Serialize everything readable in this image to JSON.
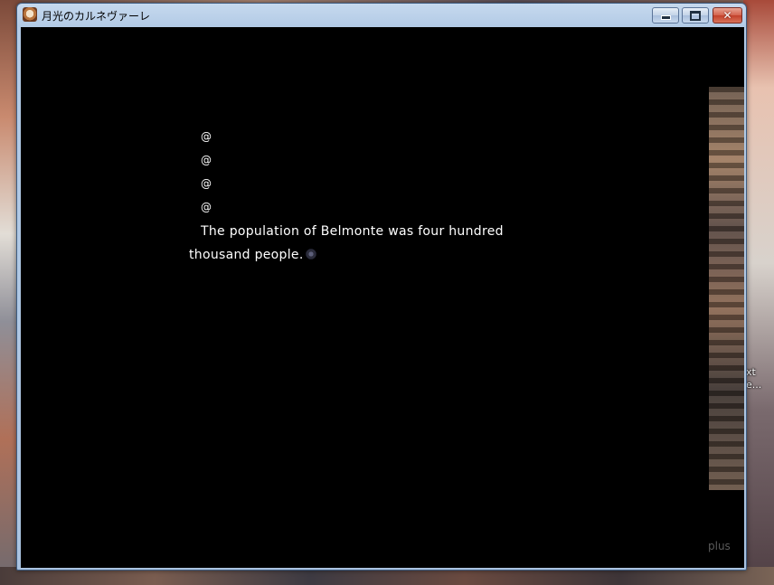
{
  "window": {
    "title": "月光のカルネヴァーレ",
    "controls": {
      "minimize": "minimize",
      "maximize": "maximize",
      "close": "✕"
    }
  },
  "game_text": {
    "markers": [
      "@",
      "@",
      "@",
      "@"
    ],
    "line1": "The population of Belmonte was four hundred",
    "line2": "thousand people."
  },
  "overlay": {
    "plus_label": "plus"
  },
  "desktop": {
    "fragment1": "xt",
    "fragment2": "e..."
  },
  "colors": {
    "text": "#ffffff",
    "background": "#000000"
  }
}
